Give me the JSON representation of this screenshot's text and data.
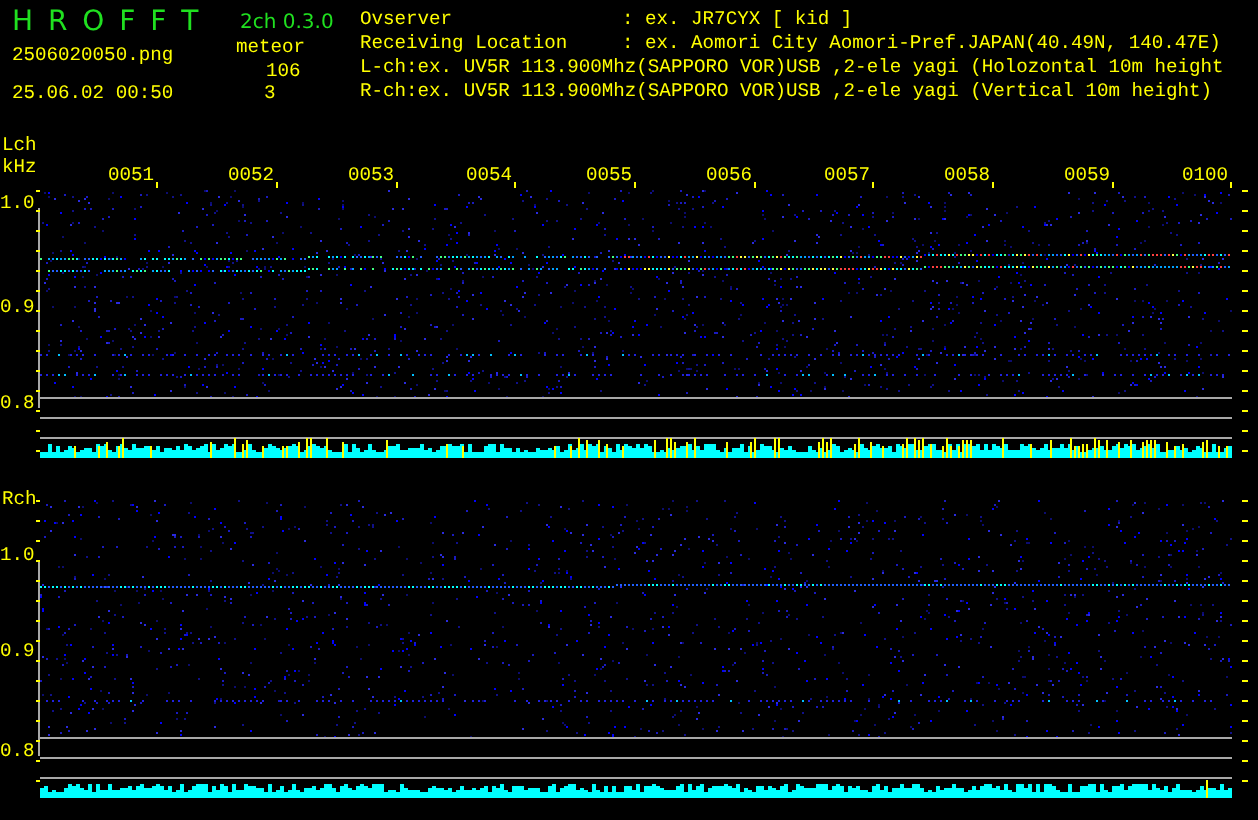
{
  "app": {
    "title": "H R O F F T",
    "version": "2ch 0.3.0",
    "filename": "2506020050.png",
    "datetime": "25.06.02 00:50"
  },
  "counts": {
    "label": "meteor",
    "lch": "106",
    "rch": "3"
  },
  "info": [
    {
      "label": "Ovserver",
      "value": ": ex. JR7CYX [ kid ]"
    },
    {
      "label": "Receiving Location",
      "value": ": ex. Aomori City Aomori-Pref.JAPAN(40.49N, 140.47E)"
    }
  ],
  "channels_info": [
    "L-ch:ex. UV5R 113.900Mhz(SAPPORO VOR)USB ,2-ele yagi (Holozontal 10m height",
    "R-ch:ex. UV5R 113.900Mhz(SAPPORO VOR)USB ,2-ele yagi (Vertical 10m height)"
  ],
  "panels": [
    {
      "label": "Lch",
      "unit": "kHz",
      "time_labels": [
        "0051",
        "0052",
        "0053",
        "0054",
        "0055",
        "0056",
        "0057",
        "0058",
        "0059",
        "0100"
      ],
      "freq_labels": [
        "1.0",
        "0.9",
        "0.8"
      ]
    },
    {
      "label": "Rch",
      "freq_labels": [
        "1.0",
        "0.9",
        "0.8"
      ]
    }
  ]
}
